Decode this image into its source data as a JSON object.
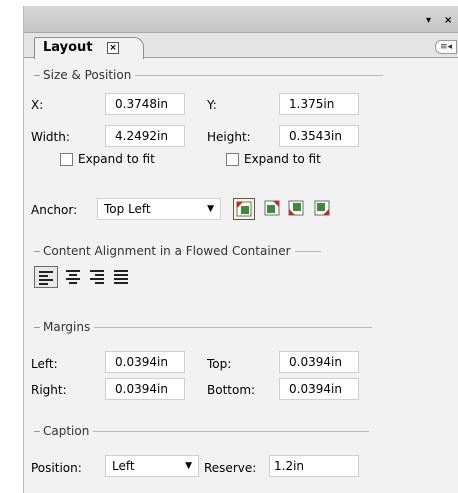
{
  "window": {
    "pin_glyph": "▾",
    "close_glyph": "×"
  },
  "tab": {
    "label": "Layout",
    "close_glyph": "×"
  },
  "panel_menu_glyph": "≡◂",
  "size_position": {
    "header": "Size & Position",
    "x_label": "X:",
    "x_value": "0.3748in",
    "y_label": "Y:",
    "y_value": "1.375in",
    "width_label": "Width:",
    "width_value": "4.2492in",
    "height_label": "Height:",
    "height_value": "0.3543in",
    "expand_width_label": "Expand to fit",
    "expand_height_label": "Expand to fit",
    "anchor_label": "Anchor:",
    "anchor_value": "Top Left"
  },
  "content_alignment": {
    "header": "Content Alignment in a Flowed Container"
  },
  "margins": {
    "header": "Margins",
    "left_label": "Left:",
    "left_value": "0.0394in",
    "top_label": "Top:",
    "top_value": "0.0394in",
    "right_label": "Right:",
    "right_value": "0.0394in",
    "bottom_label": "Bottom:",
    "bottom_value": "0.0394in"
  },
  "caption": {
    "header": "Caption",
    "position_label": "Position:",
    "position_value": "Left",
    "reserve_label": "Reserve:",
    "reserve_value": "1.2in"
  }
}
